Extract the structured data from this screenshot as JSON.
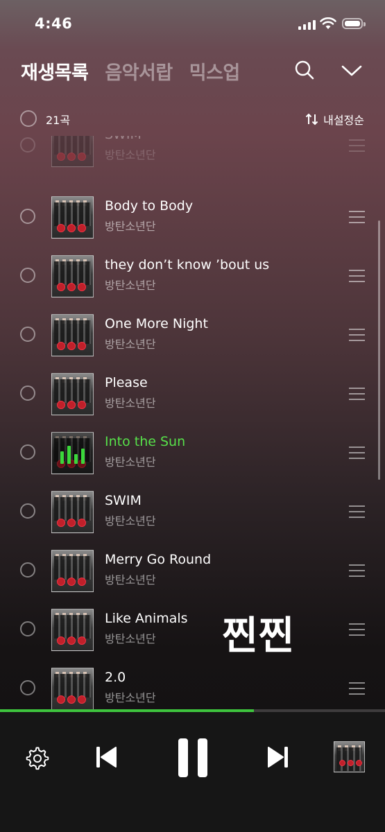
{
  "status_bar": {
    "time": "4:46"
  },
  "header": {
    "tabs": [
      {
        "label": "재생목록",
        "active": true
      },
      {
        "label": "음악서랍",
        "active": false
      },
      {
        "label": "믹스업",
        "active": false
      }
    ],
    "search_icon": "search-icon",
    "collapse_icon": "chevron-down-icon"
  },
  "toolbar": {
    "count": "21곡",
    "sort_label": "내설정순"
  },
  "tracks": [
    {
      "title": "SWIM",
      "artist": "방탄소년단",
      "playing": false,
      "partial": true
    },
    {
      "title": "Body to Body",
      "artist": "방탄소년단",
      "playing": false
    },
    {
      "title": "they don’t know ’bout us",
      "artist": "방탄소년단",
      "playing": false
    },
    {
      "title": "One More Night",
      "artist": "방탄소년단",
      "playing": false
    },
    {
      "title": "Please",
      "artist": "방탄소년단",
      "playing": false
    },
    {
      "title": "Into the Sun",
      "artist": "방탄소년단",
      "playing": true
    },
    {
      "title": "SWIM",
      "artist": "방탄소년단",
      "playing": false
    },
    {
      "title": "Merry Go Round",
      "artist": "방탄소년단",
      "playing": false
    },
    {
      "title": "Like Animals",
      "artist": "방탄소년단",
      "playing": false
    },
    {
      "title": "2.0",
      "artist": "방탄소년단",
      "playing": false
    }
  ],
  "overlay_text": "찐찐",
  "player": {
    "progress": 0.66,
    "accent_color": "#3ec43e",
    "playing_color": "#57e04a",
    "controls": [
      "settings-icon",
      "previous-icon",
      "pause-icon",
      "next-icon"
    ]
  }
}
